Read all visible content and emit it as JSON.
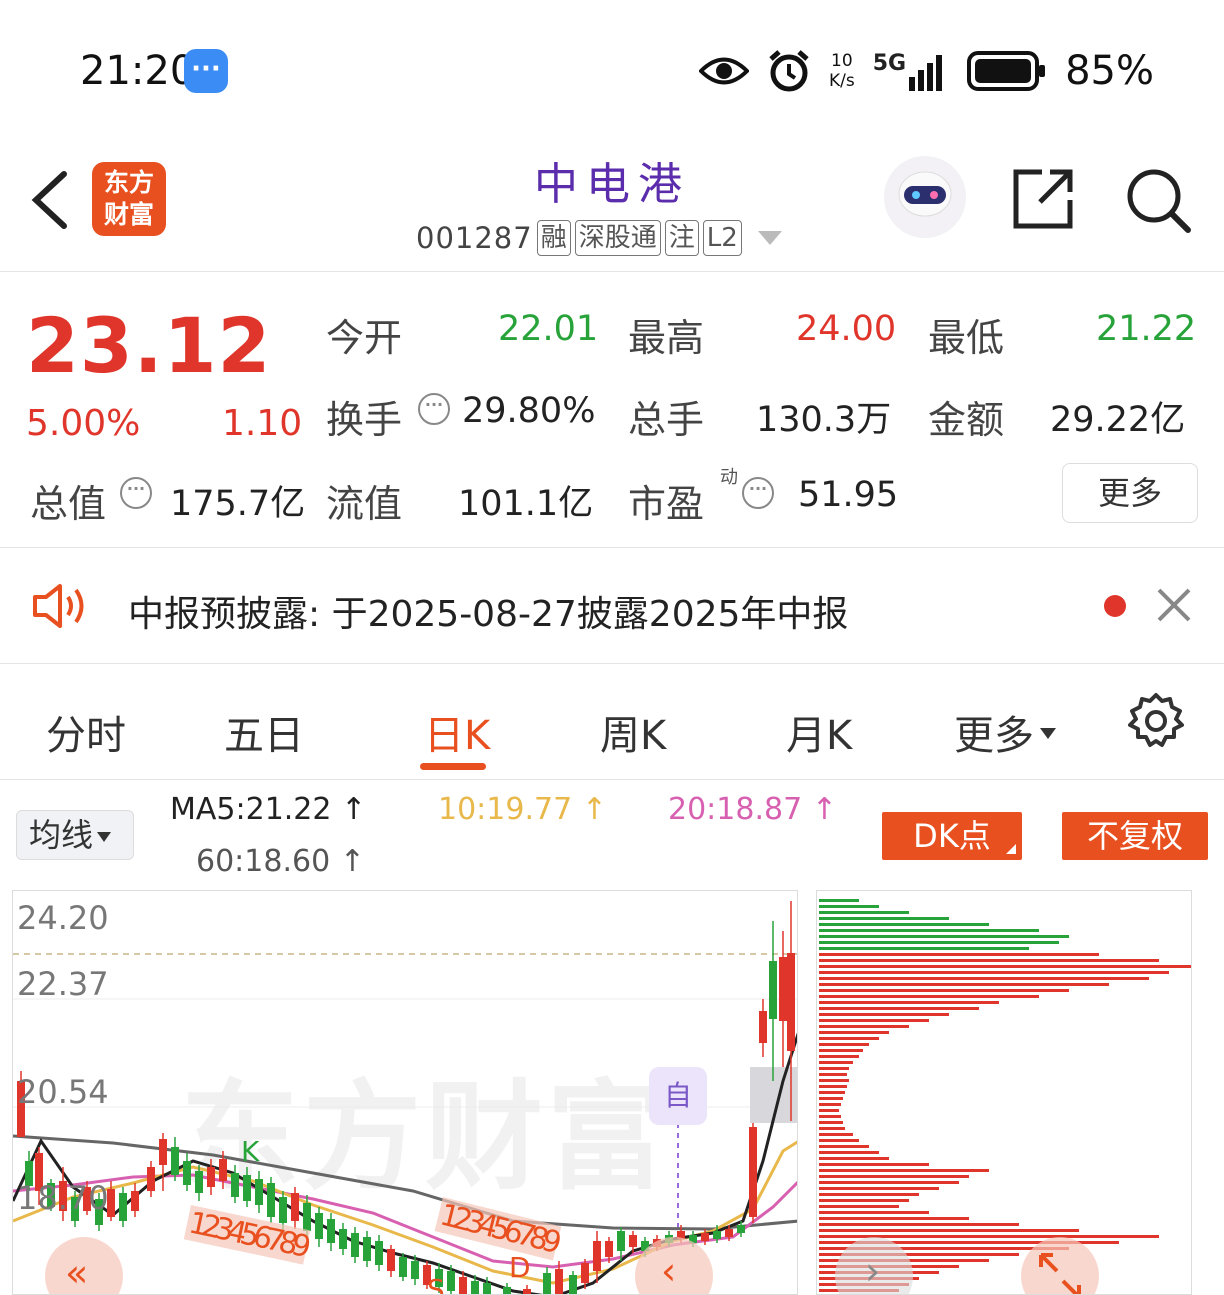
{
  "status_bar": {
    "time": "21:20",
    "net_speed_value": "10",
    "net_speed_unit": "K/s",
    "network": "5G",
    "battery": "85%"
  },
  "header": {
    "app_logo_line1": "东方",
    "app_logo_line2": "财富",
    "stock_name": "中电港",
    "stock_code": "001287",
    "tags": [
      "融",
      "深股通",
      "注",
      "L2"
    ]
  },
  "quote": {
    "price": "23.12",
    "change_pct": "5.00%",
    "change": "1.10",
    "open_label": "今开",
    "open": "22.01",
    "high_label": "最高",
    "high": "24.00",
    "low_label": "最低",
    "low": "21.22",
    "turnover_label": "换手",
    "turnover": "29.80%",
    "volume_label": "总手",
    "volume": "130.3万",
    "amount_label": "金额",
    "amount": "29.22亿",
    "mcap_label": "总值",
    "mcap": "175.7亿",
    "float_label": "流值",
    "float": "101.1亿",
    "pe_label": "市盈",
    "pe_tag": "动",
    "pe": "51.95",
    "more_label": "更多"
  },
  "notice": {
    "text": "中报预披露:  于2025-08-27披露2025年中报"
  },
  "tabs": {
    "items": [
      "分时",
      "五日",
      "日K",
      "周K",
      "月K",
      "更多"
    ],
    "active": "日K"
  },
  "ma": {
    "selector": "均线",
    "ma5": "MA5:21.22 ↑",
    "ma10": "10:19.77 ↑",
    "ma20": "20:18.87 ↑",
    "ma60": "60:18.60 ↑",
    "dk_button": "DK点",
    "adjust_button": "不复权",
    "colors": {
      "ma5": "#222222",
      "ma10": "#e8b84a",
      "ma20": "#d860b0",
      "ma60": "#666666"
    }
  },
  "chart": {
    "price_labels": [
      "24.20",
      "22.37",
      "20.54",
      "18.70"
    ],
    "watermark": "东方财富",
    "signal_badge": "自",
    "marker_k": "K",
    "sequence_1": "123456789",
    "sequence_2": "123456789",
    "marker_s": "S",
    "marker_d": "D",
    "up_color": "#e0352b",
    "down_color": "#27a33a"
  }
}
